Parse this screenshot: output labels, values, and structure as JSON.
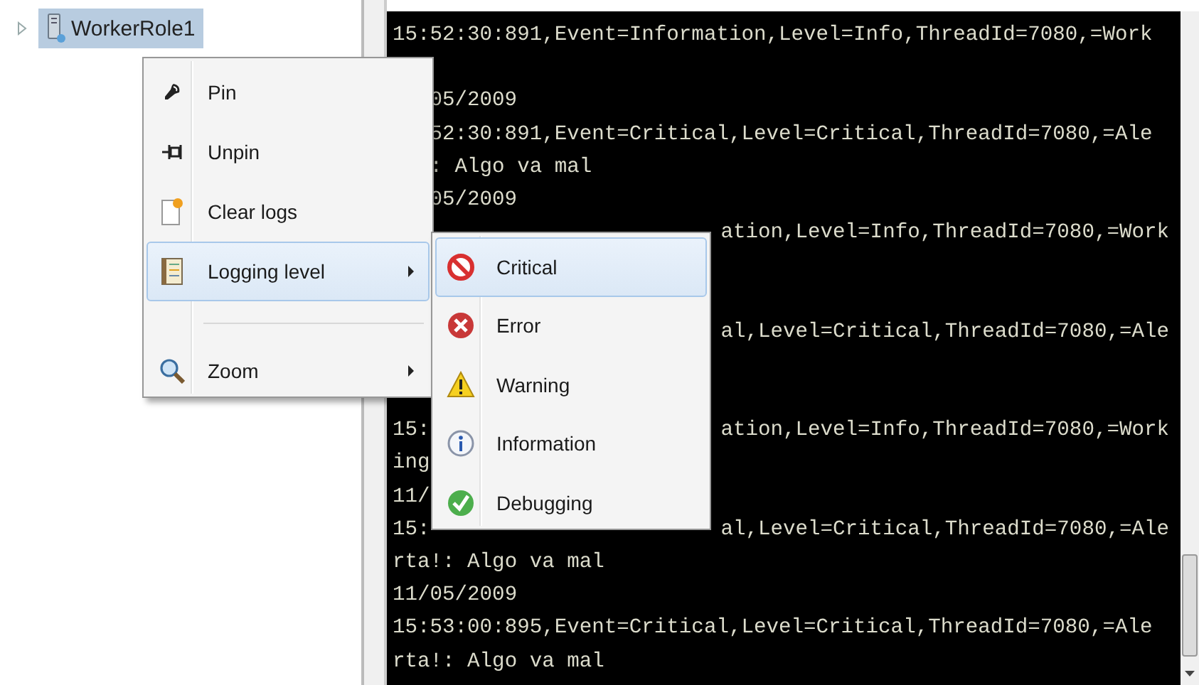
{
  "tree": {
    "items": [
      {
        "label": "WorkerRole1",
        "selected": true,
        "expanded": false
      }
    ]
  },
  "log": {
    "lines": [
      {
        "kind": "full",
        "text": "15:52:30:891,Event=Information,Level=Info,ThreadId=7080,=Work"
      },
      {
        "kind": "blank"
      },
      {
        "kind": "after_menu",
        "text": "05/2009"
      },
      {
        "kind": "after_menu",
        "text": "52:30:891,Event=Critical,Level=Critical,ThreadId=7080,=Ale"
      },
      {
        "kind": "after_menu",
        "text": ": Algo va mal"
      },
      {
        "kind": "after_menu",
        "text": "05/2009"
      },
      {
        "kind": "split",
        "right": "ation,Level=Info,ThreadId=7080,=Work"
      },
      {
        "kind": "blank"
      },
      {
        "kind": "blank"
      },
      {
        "kind": "split",
        "right": "al,Level=Critical,ThreadId=7080,=Ale"
      },
      {
        "kind": "blank"
      },
      {
        "kind": "blank"
      },
      {
        "kind": "split",
        "left": "15:",
        "right": "ation,Level=Info,ThreadId=7080,=Work"
      },
      {
        "kind": "full",
        "text": "ing"
      },
      {
        "kind": "full",
        "text": "11/"
      },
      {
        "kind": "split",
        "left": "15:",
        "right": "al,Level=Critical,ThreadId=7080,=Ale"
      },
      {
        "kind": "full",
        "text": "rta!: Algo va mal"
      },
      {
        "kind": "full",
        "text": "11/05/2009"
      },
      {
        "kind": "full",
        "text": "15:53:00:895,Event=Critical,Level=Critical,ThreadId=7080,=Ale"
      },
      {
        "kind": "full",
        "text": "rta!: Algo va mal"
      }
    ]
  },
  "context_menu": {
    "items": [
      {
        "kind": "item",
        "label": "Pin",
        "selected": false,
        "submenu": false
      },
      {
        "kind": "item",
        "label": "Unpin",
        "selected": false,
        "submenu": false
      },
      {
        "kind": "item",
        "label": "Clear logs",
        "selected": false,
        "submenu": false
      },
      {
        "kind": "item",
        "label": "Logging level",
        "selected": true,
        "submenu": true
      },
      {
        "kind": "separator"
      },
      {
        "kind": "item",
        "label": "Zoom",
        "selected": false,
        "submenu": true
      }
    ]
  },
  "submenu": {
    "items": [
      {
        "label": "Critical",
        "selected": true
      },
      {
        "label": "Error",
        "selected": false
      },
      {
        "label": "Warning",
        "selected": false
      },
      {
        "label": "Information",
        "selected": false
      },
      {
        "label": "Debugging",
        "selected": false
      }
    ]
  }
}
